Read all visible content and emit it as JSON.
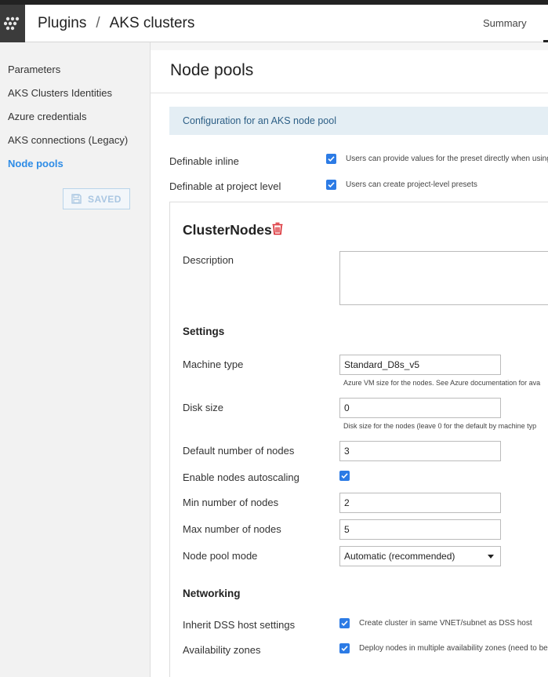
{
  "header": {
    "breadcrumb": [
      "Plugins",
      "AKS clusters"
    ],
    "separator": "/",
    "summary_tab": "Summary"
  },
  "sidebar": {
    "items": [
      {
        "label": "Parameters",
        "active": false
      },
      {
        "label": "AKS Clusters Identities",
        "active": false
      },
      {
        "label": "Azure credentials",
        "active": false
      },
      {
        "label": "AKS connections (Legacy)",
        "active": false
      },
      {
        "label": "Node pools",
        "active": true
      }
    ],
    "saved_label": "SAVED"
  },
  "main": {
    "title": "Node pools",
    "banner": "Configuration for an AKS node pool",
    "definable_inline": {
      "label": "Definable inline",
      "checked": true,
      "hint": "Users can provide values for the preset directly when using t"
    },
    "definable_project": {
      "label": "Definable at project level",
      "checked": true,
      "hint": "Users can create project-level presets"
    }
  },
  "preset": {
    "name": "ClusterNodes",
    "description_label": "Description",
    "description_value": "",
    "settings_heading": "Settings",
    "machine_type": {
      "label": "Machine type",
      "value": "Standard_D8s_v5",
      "hint": "Azure VM size for the nodes. See Azure documentation for ava"
    },
    "disk_size": {
      "label": "Disk size",
      "value": "0",
      "hint": "Disk size for the nodes (leave 0 for the default by machine typ"
    },
    "default_nodes": {
      "label": "Default number of nodes",
      "value": "3"
    },
    "autoscaling": {
      "label": "Enable nodes autoscaling",
      "checked": true
    },
    "min_nodes": {
      "label": "Min number of nodes",
      "value": "2"
    },
    "max_nodes": {
      "label": "Max number of nodes",
      "value": "5"
    },
    "pool_mode": {
      "label": "Node pool mode",
      "value": "Automatic (recommended)"
    },
    "networking_heading": "Networking",
    "inherit_dss": {
      "label": "Inherit DSS host settings",
      "checked": true,
      "hint": "Create cluster in same VNET/subnet as DSS host"
    },
    "availability_zones": {
      "label": "Availability zones",
      "checked": true,
      "hint": "Deploy nodes in multiple availability zones (need to be s"
    }
  },
  "colors": {
    "accent": "#2c7be5",
    "active_nav": "#2e8ce6",
    "banner_bg": "#e4eef4",
    "banner_text": "#2d5f86",
    "delete_icon": "#d9262c"
  },
  "icons": {
    "logo": "dataiku-bird-logo",
    "saved": "floppy-disk-icon",
    "delete": "trash-icon",
    "check": "checkmark-icon",
    "dropdown": "caret-down-icon"
  }
}
